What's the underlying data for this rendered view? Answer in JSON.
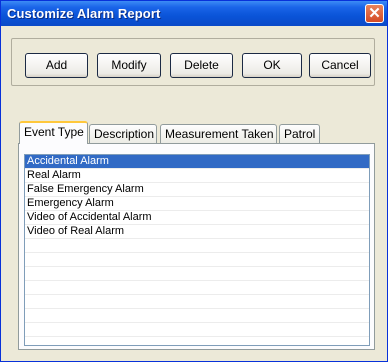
{
  "window": {
    "title": "Customize Alarm Report",
    "close_symbol": "✕"
  },
  "toolbar": {
    "add_label": "Add",
    "modify_label": "Modify",
    "delete_label": "Delete",
    "ok_label": "OK",
    "cancel_label": "Cancel"
  },
  "tabs": [
    {
      "label": "Event Type",
      "active": true
    },
    {
      "label": "Description",
      "active": false
    },
    {
      "label": "Measurement Taken",
      "active": false
    },
    {
      "label": "Patrol",
      "active": false
    }
  ],
  "list": {
    "items": [
      {
        "label": "Accidental Alarm",
        "selected": true
      },
      {
        "label": "Real Alarm",
        "selected": false
      },
      {
        "label": "False Emergency Alarm",
        "selected": false
      },
      {
        "label": "Emergency Alarm",
        "selected": false
      },
      {
        "label": "Video of Accidental Alarm",
        "selected": false
      },
      {
        "label": "Video of Real Alarm",
        "selected": false
      }
    ]
  },
  "colors": {
    "titlebar": "#0A54D8",
    "selection": "#316AC5",
    "dialog_bg": "#ECE9D8"
  }
}
